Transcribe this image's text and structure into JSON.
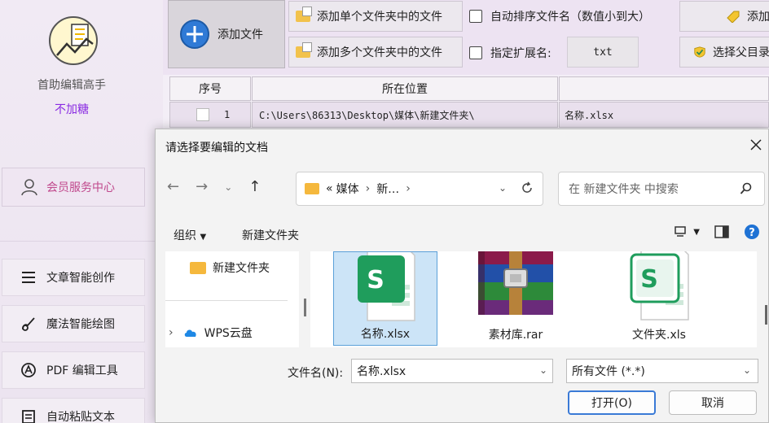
{
  "sidebar": {
    "app_name": "首助编辑高手",
    "app_subtitle": "不加糖",
    "member_center": "会员服务中心",
    "items": [
      {
        "label": "文章智能创作",
        "icon": "list-icon"
      },
      {
        "label": "魔法智能绘图",
        "icon": "brush-icon"
      },
      {
        "label": "PDF 编辑工具",
        "icon": "pdf-icon"
      },
      {
        "label": "自动粘贴文本",
        "icon": "paste-icon"
      }
    ]
  },
  "toolbar": {
    "add_file": "添加文件",
    "add_single_folder": "添加单个文件夹中的文件",
    "add_multi_folder": "添加多个文件夹中的文件",
    "auto_sort": "自动排序文件名（数值小到大）",
    "specify_ext": "指定扩展名:",
    "ext_value": "txt",
    "add_partial": "添加",
    "select_parent": "选择父目录"
  },
  "table": {
    "headers": [
      "序号",
      "所在位置"
    ],
    "rows": [
      {
        "index": "1",
        "location": "C:\\Users\\86313\\Desktop\\媒体\\新建文件夹\\",
        "name": "名称.xlsx"
      }
    ]
  },
  "dialog": {
    "title": "请选择要编辑的文档",
    "breadcrumb": [
      "«",
      "媒体",
      "新…"
    ],
    "search_placeholder": "在 新建文件夹 中搜索",
    "organize": "组织",
    "new_folder": "新建文件夹",
    "nav": [
      {
        "label": "新建文件夹"
      },
      {
        "label": "WPS云盘"
      }
    ],
    "files": [
      {
        "name": "名称.xlsx",
        "type": "xlsx",
        "selected": true
      },
      {
        "name": "素材库.rar",
        "type": "rar",
        "selected": false
      },
      {
        "name": "文件夹.xls",
        "type": "xls",
        "selected": false
      }
    ],
    "filename_label": "文件名(N):",
    "filename_value": "名称.xlsx",
    "filetype_value": "所有文件 (*.*)",
    "open_button": "打开(O)",
    "cancel_button": "取消"
  },
  "colors": {
    "sidebar_bg": "#efe8f3",
    "accent_purple": "#8a2be2",
    "member_pink": "#c0488c",
    "primary_blue": "#3a7ad6",
    "xlsx_green": "#1f9d5c"
  }
}
